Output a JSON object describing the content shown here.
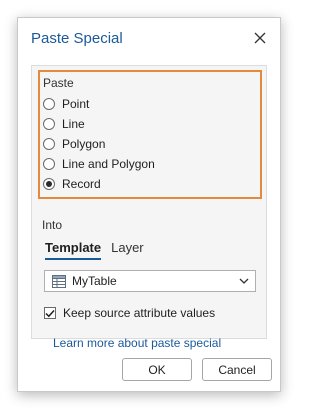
{
  "dialog": {
    "title": "Paste Special",
    "paste_section": {
      "label": "Paste",
      "options": [
        {
          "label": "Point",
          "checked": false
        },
        {
          "label": "Line",
          "checked": false
        },
        {
          "label": "Polygon",
          "checked": false
        },
        {
          "label": "Line and Polygon",
          "checked": false
        },
        {
          "label": "Record",
          "checked": true
        }
      ]
    },
    "into_section": {
      "label": "Into",
      "tabs": [
        {
          "label": "Template",
          "active": true
        },
        {
          "label": "Layer",
          "active": false
        }
      ],
      "selected_table": "MyTable",
      "table_icon": "table-icon"
    },
    "keep_attributes": {
      "label": "Keep source attribute values",
      "checked": true
    },
    "learn_more_link": "Learn more about paste special",
    "buttons": {
      "ok": "OK",
      "cancel": "Cancel"
    },
    "colors": {
      "accent": "#1a5a9a",
      "highlight_border": "#e48a3e"
    }
  }
}
